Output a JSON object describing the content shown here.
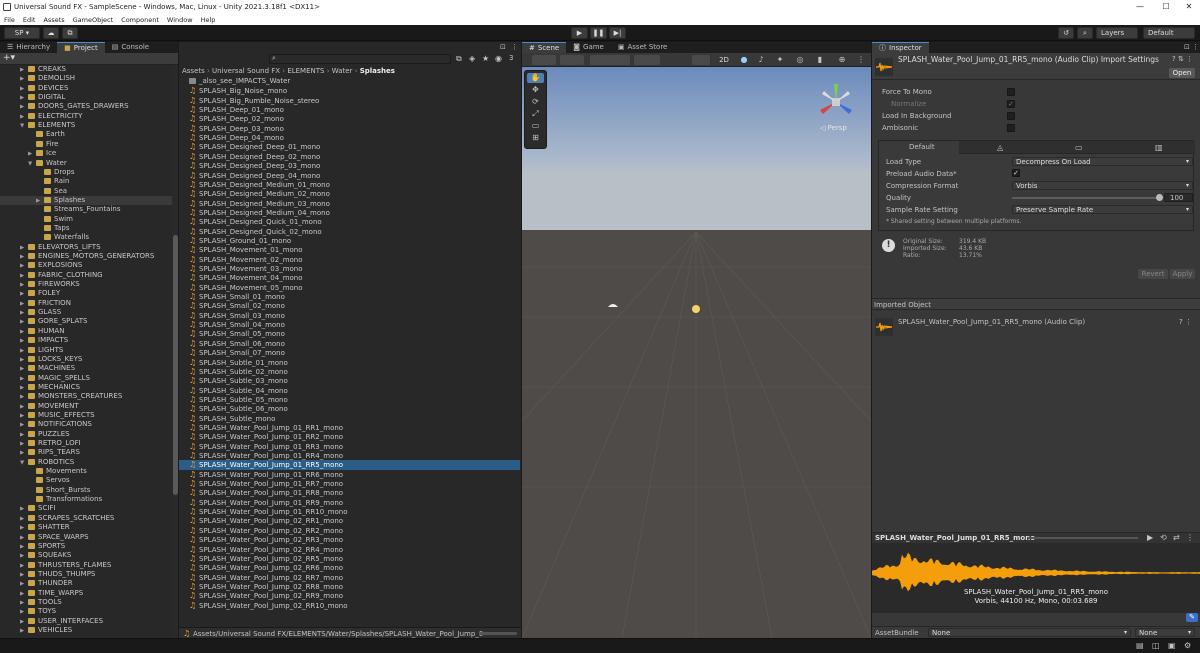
{
  "window": {
    "title": "Universal Sound FX - SampleScene - Windows, Mac, Linux - Unity 2021.3.18f1 <DX11>",
    "minimize": "—",
    "maximize": "☐",
    "close": "✕"
  },
  "menu": [
    "File",
    "Edit",
    "Assets",
    "GameObject",
    "Component",
    "Window",
    "Help"
  ],
  "toolbar": {
    "account": "SP ▾",
    "layers": "Layers",
    "layout": "Default"
  },
  "left_tabs": {
    "hierarchy": "Hierarchy",
    "project": "Project",
    "console": "Console",
    "hidden_count": "3"
  },
  "breadcrumb": {
    "parts": [
      "Assets",
      "Universal Sound FX",
      "ELEMENTS",
      "Water",
      "Splashes"
    ]
  },
  "tree": [
    {
      "label": "CREAKS",
      "indent": 0,
      "expand": "▶"
    },
    {
      "label": "DEMOLISH",
      "indent": 0,
      "expand": "▶"
    },
    {
      "label": "DEVICES",
      "indent": 0,
      "expand": "▶"
    },
    {
      "label": "DIGITAL",
      "indent": 0,
      "expand": "▶"
    },
    {
      "label": "DOORS_GATES_DRAWERS",
      "indent": 0,
      "expand": "▶"
    },
    {
      "label": "ELECTRICITY",
      "indent": 0,
      "expand": "▶"
    },
    {
      "label": "ELEMENTS",
      "indent": 0,
      "expand": "▼"
    },
    {
      "label": "Earth",
      "indent": 1,
      "expand": ""
    },
    {
      "label": "Fire",
      "indent": 1,
      "expand": ""
    },
    {
      "label": "Ice",
      "indent": 1,
      "expand": "▶"
    },
    {
      "label": "Water",
      "indent": 1,
      "expand": "▼"
    },
    {
      "label": "Drops",
      "indent": 2,
      "expand": ""
    },
    {
      "label": "Rain",
      "indent": 2,
      "expand": ""
    },
    {
      "label": "Sea",
      "indent": 2,
      "expand": ""
    },
    {
      "label": "Splashes",
      "indent": 2,
      "expand": "▶",
      "selected": true
    },
    {
      "label": "Streams_Fountains",
      "indent": 2,
      "expand": ""
    },
    {
      "label": "Swim",
      "indent": 2,
      "expand": ""
    },
    {
      "label": "Taps",
      "indent": 2,
      "expand": ""
    },
    {
      "label": "Waterfalls",
      "indent": 2,
      "expand": ""
    },
    {
      "label": "ELEVATORS_LIFTS",
      "indent": 0,
      "expand": "▶"
    },
    {
      "label": "ENGINES_MOTORS_GENERATORS",
      "indent": 0,
      "expand": "▶"
    },
    {
      "label": "EXPLOSIONS",
      "indent": 0,
      "expand": "▶"
    },
    {
      "label": "FABRIC_CLOTHING",
      "indent": 0,
      "expand": "▶"
    },
    {
      "label": "FIREWORKS",
      "indent": 0,
      "expand": "▶"
    },
    {
      "label": "FOLEY",
      "indent": 0,
      "expand": "▶"
    },
    {
      "label": "FRICTION",
      "indent": 0,
      "expand": "▶"
    },
    {
      "label": "GLASS",
      "indent": 0,
      "expand": "▶"
    },
    {
      "label": "GORE_SPLATS",
      "indent": 0,
      "expand": "▶"
    },
    {
      "label": "HUMAN",
      "indent": 0,
      "expand": "▶"
    },
    {
      "label": "IMPACTS",
      "indent": 0,
      "expand": "▶"
    },
    {
      "label": "LIGHTS",
      "indent": 0,
      "expand": "▶"
    },
    {
      "label": "LOCKS_KEYS",
      "indent": 0,
      "expand": "▶"
    },
    {
      "label": "MACHINES",
      "indent": 0,
      "expand": "▶"
    },
    {
      "label": "MAGIC_SPELLS",
      "indent": 0,
      "expand": "▶"
    },
    {
      "label": "MECHANICS",
      "indent": 0,
      "expand": "▶"
    },
    {
      "label": "MONSTERS_CREATURES",
      "indent": 0,
      "expand": "▶"
    },
    {
      "label": "MOVEMENT",
      "indent": 0,
      "expand": "▶"
    },
    {
      "label": "MUSIC_EFFECTS",
      "indent": 0,
      "expand": "▶"
    },
    {
      "label": "NOTIFICATIONS",
      "indent": 0,
      "expand": "▶"
    },
    {
      "label": "PUZZLES",
      "indent": 0,
      "expand": "▶"
    },
    {
      "label": "RETRO_LOFI",
      "indent": 0,
      "expand": "▶"
    },
    {
      "label": "RIPS_TEARS",
      "indent": 0,
      "expand": "▶"
    },
    {
      "label": "ROBOTICS",
      "indent": 0,
      "expand": "▼"
    },
    {
      "label": "Movements",
      "indent": 1,
      "expand": ""
    },
    {
      "label": "Servos",
      "indent": 1,
      "expand": ""
    },
    {
      "label": "Short_Bursts",
      "indent": 1,
      "expand": ""
    },
    {
      "label": "Transformations",
      "indent": 1,
      "expand": ""
    },
    {
      "label": "SCIFI",
      "indent": 0,
      "expand": "▶"
    },
    {
      "label": "SCRAPES_SCRATCHES",
      "indent": 0,
      "expand": "▶"
    },
    {
      "label": "SHATTER",
      "indent": 0,
      "expand": "▶"
    },
    {
      "label": "SPACE_WARPS",
      "indent": 0,
      "expand": "▶"
    },
    {
      "label": "SPORTS",
      "indent": 0,
      "expand": "▶"
    },
    {
      "label": "SQUEAKS",
      "indent": 0,
      "expand": "▶"
    },
    {
      "label": "THRUSTERS_FLAMES",
      "indent": 0,
      "expand": "▶"
    },
    {
      "label": "THUDS_THUMPS",
      "indent": 0,
      "expand": "▶"
    },
    {
      "label": "THUNDER",
      "indent": 0,
      "expand": "▶"
    },
    {
      "label": "TIME_WARPS",
      "indent": 0,
      "expand": "▶"
    },
    {
      "label": "TOOLS",
      "indent": 0,
      "expand": "▶"
    },
    {
      "label": "TOYS",
      "indent": 0,
      "expand": "▶"
    },
    {
      "label": "USER_INTERFACES",
      "indent": 0,
      "expand": "▶"
    },
    {
      "label": "VEHICLES",
      "indent": 0,
      "expand": "▶"
    }
  ],
  "files": [
    {
      "label": "_also_see_IMPACTS_Water",
      "kind": "folder"
    },
    {
      "label": "SPLASH_Big_Noise_mono",
      "kind": "audio"
    },
    {
      "label": "SPLASH_Big_Rumble_Noise_stereo",
      "kind": "audio"
    },
    {
      "label": "SPLASH_Deep_01_mono",
      "kind": "audio"
    },
    {
      "label": "SPLASH_Deep_02_mono",
      "kind": "audio"
    },
    {
      "label": "SPLASH_Deep_03_mono",
      "kind": "audio"
    },
    {
      "label": "SPLASH_Deep_04_mono",
      "kind": "audio"
    },
    {
      "label": "SPLASH_Designed_Deep_01_mono",
      "kind": "audio"
    },
    {
      "label": "SPLASH_Designed_Deep_02_mono",
      "kind": "audio"
    },
    {
      "label": "SPLASH_Designed_Deep_03_mono",
      "kind": "audio"
    },
    {
      "label": "SPLASH_Designed_Deep_04_mono",
      "kind": "audio"
    },
    {
      "label": "SPLASH_Designed_Medium_01_mono",
      "kind": "audio"
    },
    {
      "label": "SPLASH_Designed_Medium_02_mono",
      "kind": "audio"
    },
    {
      "label": "SPLASH_Designed_Medium_03_mono",
      "kind": "audio"
    },
    {
      "label": "SPLASH_Designed_Medium_04_mono",
      "kind": "audio"
    },
    {
      "label": "SPLASH_Designed_Quick_01_mono",
      "kind": "audio"
    },
    {
      "label": "SPLASH_Designed_Quick_02_mono",
      "kind": "audio"
    },
    {
      "label": "SPLASH_Ground_01_mono",
      "kind": "audio"
    },
    {
      "label": "SPLASH_Movement_01_mono",
      "kind": "audio"
    },
    {
      "label": "SPLASH_Movement_02_mono",
      "kind": "audio"
    },
    {
      "label": "SPLASH_Movement_03_mono",
      "kind": "audio"
    },
    {
      "label": "SPLASH_Movement_04_mono",
      "kind": "audio"
    },
    {
      "label": "SPLASH_Movement_05_mono",
      "kind": "audio"
    },
    {
      "label": "SPLASH_Small_01_mono",
      "kind": "audio"
    },
    {
      "label": "SPLASH_Small_02_mono",
      "kind": "audio"
    },
    {
      "label": "SPLASH_Small_03_mono",
      "kind": "audio"
    },
    {
      "label": "SPLASH_Small_04_mono",
      "kind": "audio"
    },
    {
      "label": "SPLASH_Small_05_mono",
      "kind": "audio"
    },
    {
      "label": "SPLASH_Small_06_mono",
      "kind": "audio"
    },
    {
      "label": "SPLASH_Small_07_mono",
      "kind": "audio"
    },
    {
      "label": "SPLASH_Subtle_01_mono",
      "kind": "audio"
    },
    {
      "label": "SPLASH_Subtle_02_mono",
      "kind": "audio"
    },
    {
      "label": "SPLASH_Subtle_03_mono",
      "kind": "audio"
    },
    {
      "label": "SPLASH_Subtle_04_mono",
      "kind": "audio"
    },
    {
      "label": "SPLASH_Subtle_05_mono",
      "kind": "audio"
    },
    {
      "label": "SPLASH_Subtle_06_mono",
      "kind": "audio"
    },
    {
      "label": "SPLASH_Subtle_mono",
      "kind": "audio"
    },
    {
      "label": "SPLASH_Water_Pool_Jump_01_RR1_mono",
      "kind": "audio"
    },
    {
      "label": "SPLASH_Water_Pool_Jump_01_RR2_mono",
      "kind": "audio"
    },
    {
      "label": "SPLASH_Water_Pool_Jump_01_RR3_mono",
      "kind": "audio"
    },
    {
      "label": "SPLASH_Water_Pool_Jump_01_RR4_mono",
      "kind": "audio"
    },
    {
      "label": "SPLASH_Water_Pool_Jump_01_RR5_mono",
      "kind": "audio",
      "selected": true
    },
    {
      "label": "SPLASH_Water_Pool_Jump_01_RR6_mono",
      "kind": "audio"
    },
    {
      "label": "SPLASH_Water_Pool_Jump_01_RR7_mono",
      "kind": "audio"
    },
    {
      "label": "SPLASH_Water_Pool_Jump_01_RR8_mono",
      "kind": "audio"
    },
    {
      "label": "SPLASH_Water_Pool_Jump_01_RR9_mono",
      "kind": "audio"
    },
    {
      "label": "SPLASH_Water_Pool_Jump_01_RR10_mono",
      "kind": "audio"
    },
    {
      "label": "SPLASH_Water_Pool_Jump_02_RR1_mono",
      "kind": "audio"
    },
    {
      "label": "SPLASH_Water_Pool_Jump_02_RR2_mono",
      "kind": "audio"
    },
    {
      "label": "SPLASH_Water_Pool_Jump_02_RR3_mono",
      "kind": "audio"
    },
    {
      "label": "SPLASH_Water_Pool_Jump_02_RR4_mono",
      "kind": "audio"
    },
    {
      "label": "SPLASH_Water_Pool_Jump_02_RR5_mono",
      "kind": "audio"
    },
    {
      "label": "SPLASH_Water_Pool_Jump_02_RR6_mono",
      "kind": "audio"
    },
    {
      "label": "SPLASH_Water_Pool_Jump_02_RR7_mono",
      "kind": "audio"
    },
    {
      "label": "SPLASH_Water_Pool_Jump_02_RR8_mono",
      "kind": "audio"
    },
    {
      "label": "SPLASH_Water_Pool_Jump_02_RR9_mono",
      "kind": "audio"
    },
    {
      "label": "SPLASH_Water_Pool_Jump_02_RR10_mono",
      "kind": "audio"
    }
  ],
  "footer_path": "Assets/Universal Sound FX/ELEMENTS/Water/Splashes/SPLASH_Water_Pool_Jump_0",
  "scene": {
    "tabs": [
      "Scene",
      "Game",
      "Asset Store"
    ],
    "mode_2d": "2D",
    "persp": "◁ Persp"
  },
  "inspector": {
    "tab": "Inspector",
    "title": "SPLASH_Water_Pool_Jump_01_RR5_mono (Audio Clip) Import Settings",
    "open": "Open",
    "props": [
      {
        "label": "Force To Mono",
        "checked": false
      },
      {
        "label": "Normalize",
        "checked": true,
        "disabled": true
      },
      {
        "label": "Load In Background",
        "checked": false
      },
      {
        "label": "Ambisonic",
        "checked": false
      }
    ],
    "platform_default": "Default",
    "settings": {
      "load_type_label": "Load Type",
      "load_type": "Decompress On Load",
      "preload_label": "Preload Audio Data*",
      "preload": "✓",
      "compression_label": "Compression Format",
      "compression": "Vorbis",
      "quality_label": "Quality",
      "quality": "100",
      "quality_value": 100,
      "sample_rate_label": "Sample Rate Setting",
      "sample_rate": "Preserve Sample Rate",
      "shared_note": "* Shared setting between multiple platforms."
    },
    "info": {
      "original_label": "Original Size:",
      "original": "319.4 KB",
      "imported_label": "Imported Size:",
      "imported": "43.6 KB",
      "ratio_label": "Ratio:",
      "ratio": "13.71%"
    },
    "revert": "Revert",
    "apply": "Apply",
    "imported_object_header": "Imported Object",
    "imported_object": "SPLASH_Water_Pool_Jump_01_RR5_mono (Audio Clip)",
    "preview": {
      "title": "SPLASH_Water_Pool_Jump_01_RR5_mono",
      "clip_name": "SPLASH_Water_Pool_Jump_01_RR5_mono",
      "clip_info": "Vorbis, 44100 Hz, Mono, 00:03.689"
    },
    "assetbundle_label": "AssetBundle",
    "assetbundle": "None",
    "variant": "None"
  },
  "colors": {
    "accent": "#4a8bd4",
    "selected": "#2c5d87",
    "waveform": "#f59e0b",
    "folder": "#c9a64a"
  }
}
